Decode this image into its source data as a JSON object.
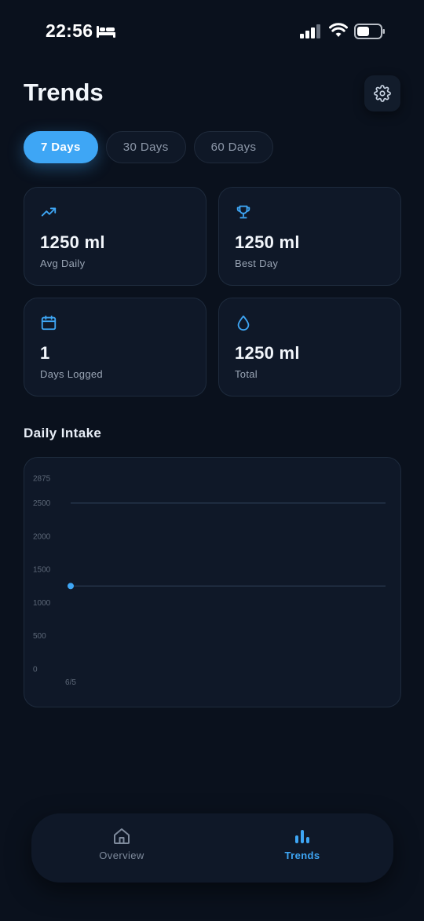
{
  "status_bar": {
    "time": "22:56",
    "icons": [
      "bed-icon",
      "signal-icon",
      "wifi-icon",
      "battery-icon"
    ]
  },
  "header": {
    "title": "Trends",
    "settings_icon": "gear-icon"
  },
  "range_tabs": [
    {
      "label": "7 Days",
      "active": true
    },
    {
      "label": "30 Days",
      "active": false
    },
    {
      "label": "60 Days",
      "active": false
    }
  ],
  "stats": [
    {
      "icon": "trend-line-icon",
      "value": "1250 ml",
      "label": "Avg Daily"
    },
    {
      "icon": "trophy-icon",
      "value": "1250 ml",
      "label": "Best Day"
    },
    {
      "icon": "calendar-icon",
      "value": "1",
      "label": "Days Logged"
    },
    {
      "icon": "water-drop-icon",
      "value": "1250 ml",
      "label": "Total"
    }
  ],
  "section": {
    "title": "Daily Intake"
  },
  "chart_data": {
    "type": "line",
    "x": [
      "6/5"
    ],
    "series": [
      {
        "values": [
          1250
        ]
      }
    ],
    "reference_lines": [
      2500,
      1250
    ],
    "y_ticks": [
      0,
      500,
      1000,
      1500,
      2000,
      2500,
      2875
    ],
    "ylim": [
      0,
      2875
    ],
    "grid": false
  },
  "colors": {
    "accent": "#3ea6f5",
    "background": "#0a111d",
    "card": "#0f1828",
    "muted_text": "#9aa5b5"
  },
  "bottom_nav": [
    {
      "label": "Overview",
      "icon": "home-icon",
      "active": false
    },
    {
      "label": "Trends",
      "icon": "bar-chart-icon",
      "active": true
    }
  ]
}
